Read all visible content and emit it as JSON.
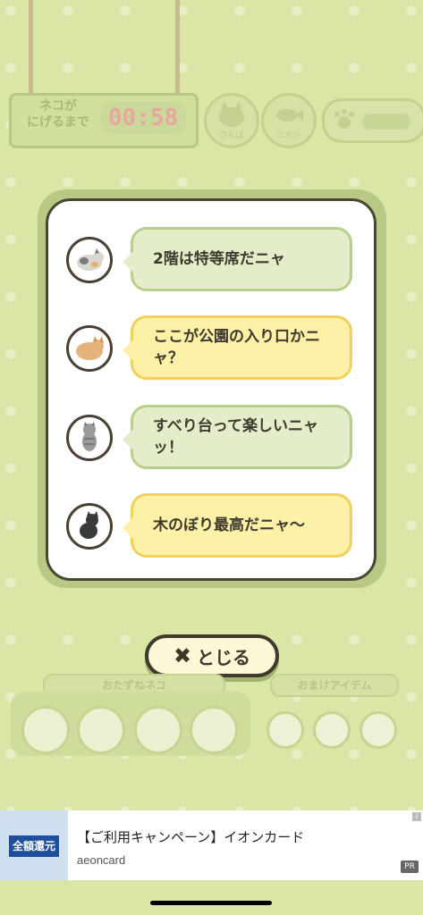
{
  "hud": {
    "timer_label_line1": "ネコが",
    "timer_label_line2": "にげるまで",
    "timer_value": "00:58",
    "cat_button_label": "さんぽ",
    "fish_button_label": "ニボシ"
  },
  "modal": {
    "messages": [
      {
        "text": "2階は特等席だニャ",
        "style": "green",
        "avatar": "gray-calico-cat-icon"
      },
      {
        "text": "ここが公園の入り口かニャ？",
        "style": "yellow",
        "avatar": "orange-fluffy-cat-icon"
      },
      {
        "text": "すべり台って楽しいニャッ！",
        "style": "green",
        "avatar": "gray-tabby-cat-icon"
      },
      {
        "text": "木のぼり最高だニャ〜",
        "style": "yellow",
        "avatar": "black-cat-icon"
      }
    ],
    "close_label": "とじる"
  },
  "lower": {
    "tab_cats": "おたずねネコ",
    "tab_items": "おまけアイテム"
  },
  "ad": {
    "title": "【ご利用キャンペーン】イオンカード",
    "advertiser": "aeoncard",
    "badge": "PR",
    "image_text": "全額還元"
  },
  "colors": {
    "background": "#d9e6a6",
    "bubble_green": "#e3edca",
    "bubble_yellow": "#fdf0a7",
    "modal_border": "#4a4632"
  }
}
